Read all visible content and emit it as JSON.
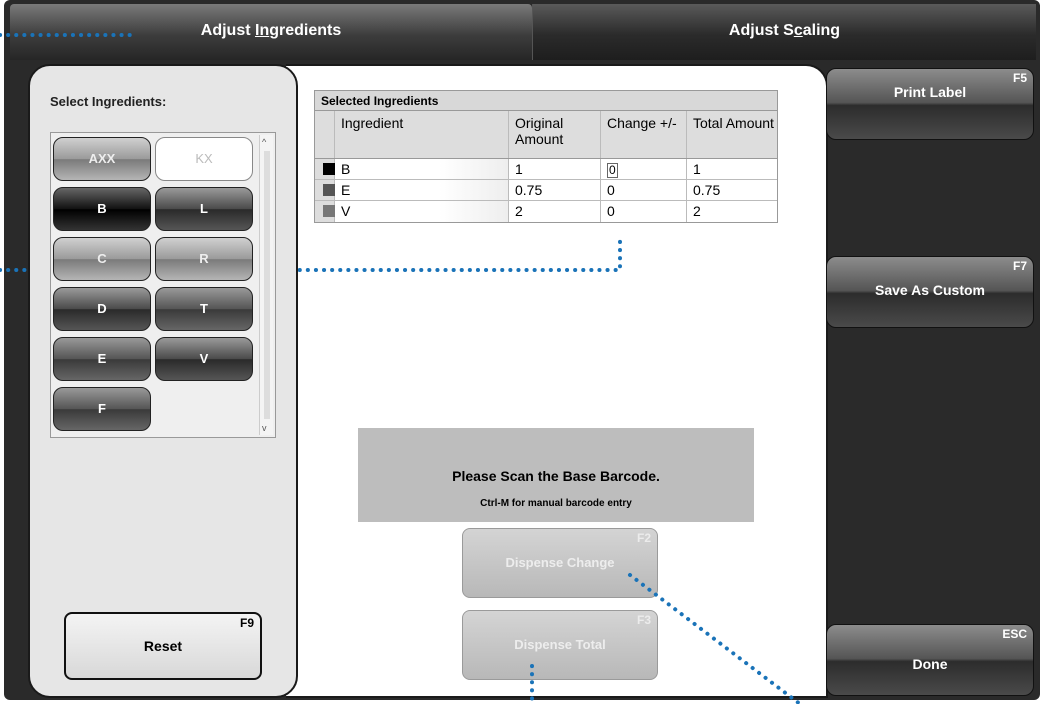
{
  "tabs": [
    {
      "pre": "Adjust ",
      "underlined": "I",
      "mid": "n",
      "rest": "gredients"
    },
    {
      "pre": "Adjust S",
      "underlined": "c",
      "rest": "aling"
    }
  ],
  "left": {
    "title": "Select Ingredients:",
    "ingredients": [
      "AXX",
      "KX",
      "B",
      "L",
      "C",
      "R",
      "D",
      "T",
      "E",
      "V",
      "F"
    ],
    "reset": {
      "label": "Reset",
      "key": "F9"
    }
  },
  "table": {
    "caption": "Selected Ingredients",
    "headers": [
      "Ingredient",
      "Original Amount",
      "Change +/-",
      "Total Amount"
    ],
    "rows": [
      {
        "ingredient": "B",
        "original": "1",
        "change": "0",
        "total": "1",
        "color": "#000000"
      },
      {
        "ingredient": "E",
        "original": "0.75",
        "change": "0",
        "total": "0.75",
        "color": "#555555"
      },
      {
        "ingredient": "V",
        "original": "2",
        "change": "0",
        "total": "2",
        "color": "#777777"
      }
    ]
  },
  "scan": {
    "message": "Please Scan the Base Barcode.",
    "hint": "Ctrl-M for manual barcode entry"
  },
  "dispense_change": {
    "label": "Dispense Change",
    "key": "F2"
  },
  "dispense_total": {
    "label": "Dispense Total",
    "key": "F3"
  },
  "right": {
    "print_label": {
      "label": "Print Label",
      "key": "F5"
    },
    "save_custom": {
      "label": "Save As Custom",
      "key": "F7"
    },
    "done": {
      "label": "Done",
      "key": "ESC"
    }
  },
  "callout_color": "#1a73b8"
}
